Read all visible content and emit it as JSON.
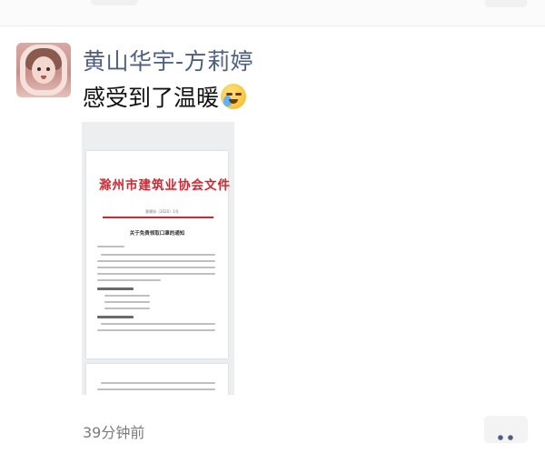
{
  "post": {
    "author": "黄山华宇-方莉婷",
    "text": "感受到了温暖",
    "emoji": "face-with-tears-of-joy-icon",
    "timestamp": "39分钟前",
    "more_icon": "more-dots-icon"
  },
  "document_preview": {
    "letterhead": "滁州市建筑业协会文件",
    "doc_number": "滁建协〔2020〕1号",
    "subtitle": "关于免费领取口罩的通知"
  },
  "colors": {
    "author_name": "#4c5f85",
    "letterhead_red": "#d8242c",
    "timestamp": "#7b7b7b",
    "more_button_bg": "#f3f3f3"
  }
}
